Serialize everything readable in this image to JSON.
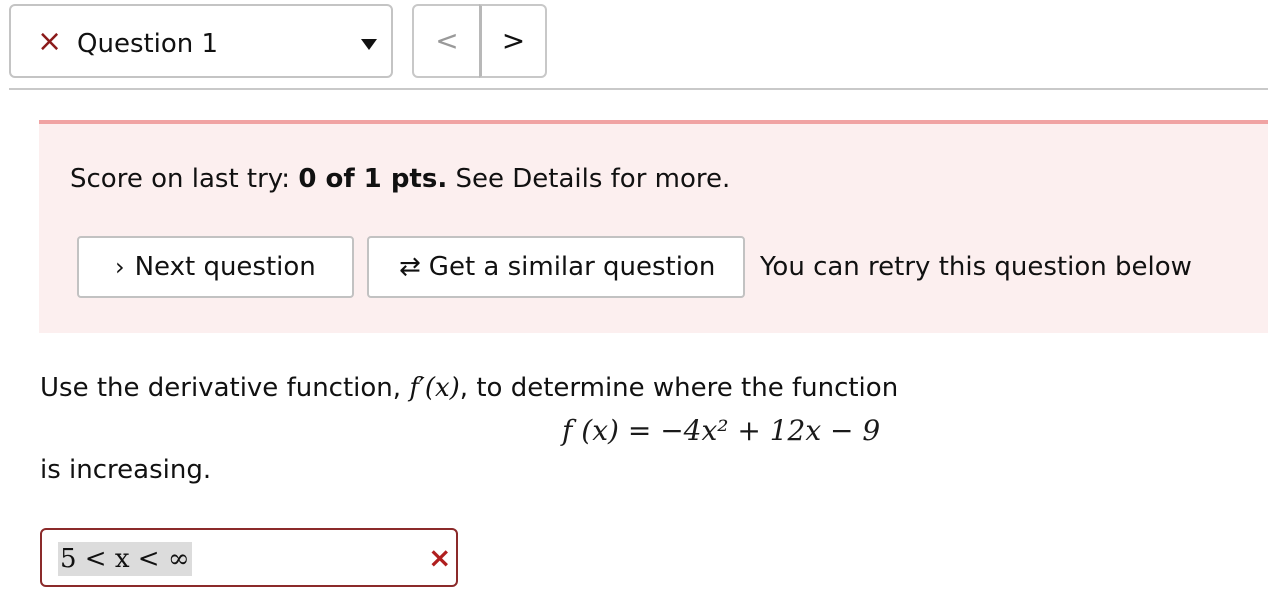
{
  "question_selector": {
    "label": "Question 1",
    "status_icon": "×"
  },
  "nav": {
    "prev": "<",
    "next": ">"
  },
  "feedback": {
    "prefix": "Score on last try:",
    "score": "0 of 1 pts.",
    "suffix": "See Details for more.",
    "next_button": "Next question",
    "similar_button": "Get a similar question",
    "retry_note": "You can retry this question below"
  },
  "question": {
    "text_before": "Use the derivative function,",
    "derivative_notation": "f′(x)",
    "text_after": ", to determine where the function",
    "function_lhs": "f (x)",
    "equals": "=",
    "function_rhs": "−4x² + 12x − 9",
    "text_end": "is increasing."
  },
  "answer": {
    "value": "5 < x < ∞",
    "status_icon": "×"
  },
  "colors": {
    "error_red": "#8b2a2a",
    "notice_bg": "#fcefef",
    "notice_border": "#f0a3a3"
  }
}
